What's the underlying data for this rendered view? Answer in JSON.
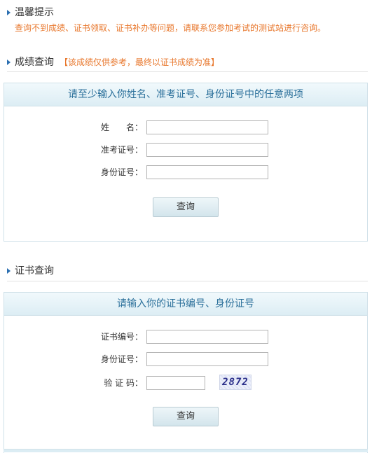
{
  "tips": {
    "title": "温馨提示",
    "text": "查询不到成绩、证书领取、证书补办等问题，请联系您参加考试的测试站进行咨询。"
  },
  "score_query": {
    "title": "成绩查询",
    "note": "【该成绩仅供参考，最终以证书成绩为准】",
    "panel_header": "请至少输入你姓名、准考证号、身份证号中的任意两项",
    "fields": [
      {
        "label": "姓　　名：",
        "value": ""
      },
      {
        "label": "准考证号：",
        "value": ""
      },
      {
        "label": "身份证号：",
        "value": ""
      }
    ],
    "button": "查询"
  },
  "cert_query": {
    "title": "证书查询",
    "panel_header": "请输入你的证书编号、身份证号",
    "fields": [
      {
        "label": "证书编号：",
        "value": ""
      },
      {
        "label": "身份证号：",
        "value": ""
      },
      {
        "label": "验 证 码：",
        "value": ""
      }
    ],
    "captcha": "2872",
    "button": "查询"
  }
}
